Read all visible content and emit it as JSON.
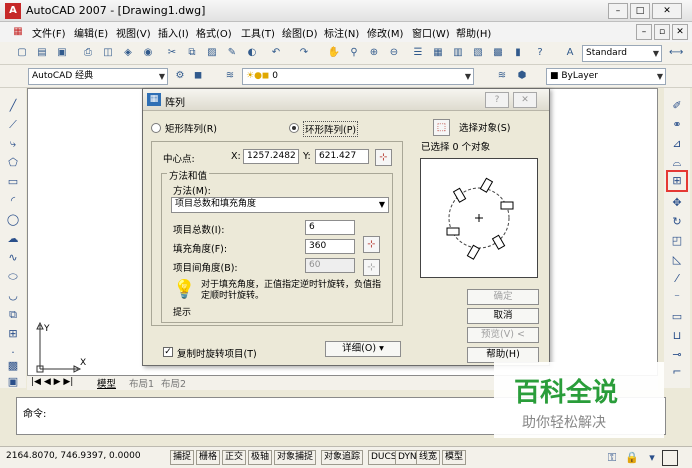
{
  "window": {
    "title": "AutoCAD 2007 - [Drawing1.dwg]"
  },
  "menu": [
    "文件(F)",
    "编辑(E)",
    "视图(V)",
    "插入(I)",
    "格式(O)",
    "工具(T)",
    "绘图(D)",
    "标注(N)",
    "修改(M)",
    "窗口(W)",
    "帮助(H)"
  ],
  "toolbar2": {
    "text_style": "Standard"
  },
  "toolbar3": {
    "workspace": "AutoCAD 经典",
    "layer": "0",
    "color": "ByLayer"
  },
  "dialog": {
    "title": "阵列",
    "rect_label": "矩形阵列(R)",
    "polar_label": "环形阵列(P)",
    "select_label": "选择对象(S)",
    "selected_text": "已选择 0 个对象",
    "center_label": "中心点:",
    "x_label": "X:",
    "x_value": "1257.2482",
    "y_label": "Y:",
    "y_value": "621.427",
    "method_group": "方法和值",
    "method_label": "方法(M):",
    "method_value": "项目总数和填充角度",
    "total_label": "项目总数(I):",
    "total_value": "6",
    "fill_label": "填充角度(F):",
    "fill_value": "360",
    "between_label": "项目间角度(B):",
    "between_value": "60",
    "tip_text": "对于填充角度，正值指定逆时针旋转，负值指定顺时针旋转。",
    "tip_label": "提示",
    "rotate_label": "复制时旋转项目(T)",
    "detail_label": "详细(O)",
    "ok": "确定",
    "cancel": "取消",
    "preview": "预览(V) <",
    "help": "帮助(H)"
  },
  "tabs": [
    "模型",
    "布局1",
    "布局2"
  ],
  "command": {
    "prompt": "命令:"
  },
  "status": {
    "coords": "2164.8070, 746.9397, 0.0000",
    "toggles": [
      "捕捉",
      "栅格",
      "正交",
      "极轴",
      "对象捕捉",
      "对象追踪",
      "DUCS",
      "DYN",
      "线宽",
      "模型"
    ]
  },
  "watermark": {
    "title": "百科全说",
    "subtitle": "助你轻松解决"
  },
  "colors": {
    "highlight": "#e53935",
    "watermark": "#2a9d3a"
  }
}
